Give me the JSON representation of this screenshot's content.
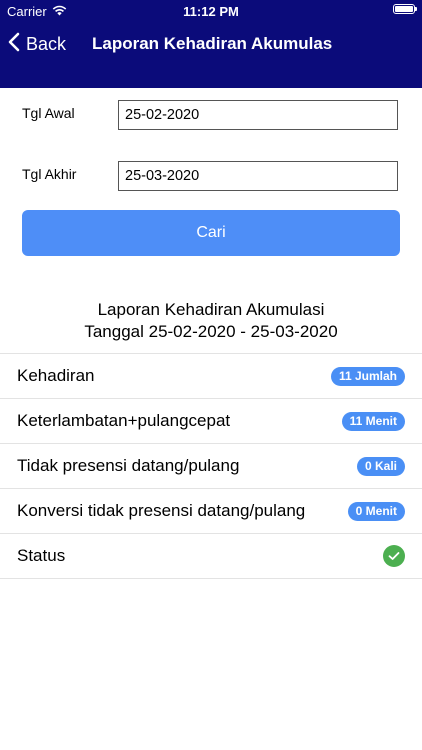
{
  "status_bar": {
    "carrier": "Carrier",
    "time": "11:12 PM",
    "icons": [
      "wifi-icon",
      "battery-icon"
    ]
  },
  "nav": {
    "back_label": "Back",
    "title": "Laporan Kehadiran Akumulas"
  },
  "form": {
    "start_label": "Tgl Awal",
    "start_value": "25-02-2020",
    "end_label": "Tgl Akhir",
    "end_value": "25-03-2020",
    "search_label": "Cari"
  },
  "report": {
    "title_line1": "Laporan Kehadiran Akumulasi",
    "title_line2": "Tanggal 25-02-2020 - 25-03-2020",
    "items": [
      {
        "label": "Kehadiran",
        "value": "11 Jumlah"
      },
      {
        "label": "Keterlambatan+pulangcepat",
        "value": "11 Menit"
      },
      {
        "label": "Tidak presensi datang/pulang",
        "value": "0 Kali"
      },
      {
        "label": "Konversi tidak presensi datang/pulang",
        "value": "0 Menit"
      },
      {
        "label": "Status",
        "value_icon": "check-icon"
      }
    ]
  },
  "colors": {
    "header": "#0b0b7a",
    "button": "#4e8ef7",
    "badge": "#4a8ff5",
    "status_ok": "#4caf50"
  }
}
